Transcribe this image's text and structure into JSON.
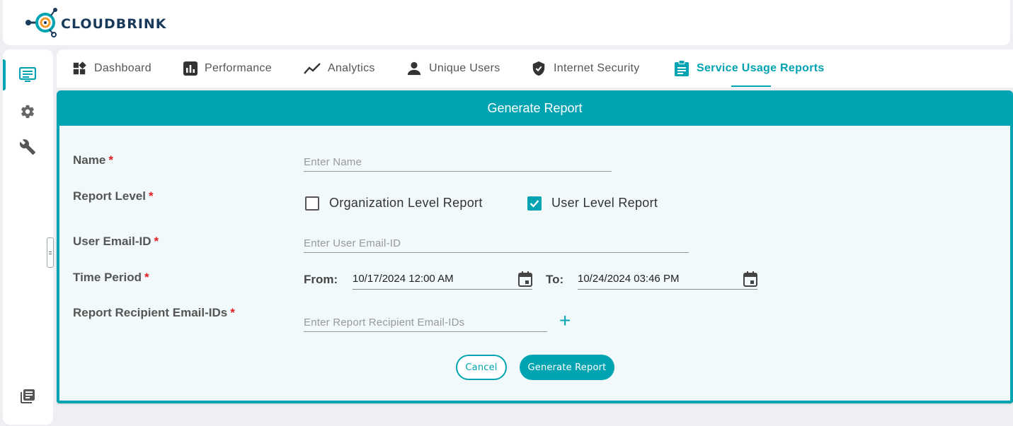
{
  "brand": {
    "name": "CLOUDBRINK",
    "accent": "#00a3b1"
  },
  "sidebar": {
    "items": [
      {
        "icon": "dashboard-list-icon",
        "active": true
      },
      {
        "icon": "gear-icon",
        "active": false
      },
      {
        "icon": "wrench-icon",
        "active": false
      }
    ],
    "bottom_icon": "library-books-icon"
  },
  "tabs": [
    {
      "label": "Dashboard",
      "icon": "dashboard-icon",
      "active": false
    },
    {
      "label": "Performance",
      "icon": "bar-chart-icon",
      "active": false
    },
    {
      "label": "Analytics",
      "icon": "trending-line-icon",
      "active": false
    },
    {
      "label": "Unique Users",
      "icon": "person-icon",
      "active": false
    },
    {
      "label": "Internet Security",
      "icon": "shield-icon",
      "active": false
    },
    {
      "label": "Service Usage Reports",
      "icon": "clipboard-icon",
      "active": true
    }
  ],
  "form": {
    "title": "Generate Report",
    "name": {
      "label": "Name",
      "required": "*",
      "placeholder": "Enter Name",
      "value": ""
    },
    "report_level": {
      "label": "Report Level",
      "required": "*",
      "options": [
        {
          "label": "Organization Level Report",
          "checked": false
        },
        {
          "label": "User Level Report",
          "checked": true
        }
      ]
    },
    "user_email": {
      "label": "User Email-ID",
      "required": "*",
      "placeholder": "Enter User Email-ID",
      "value": ""
    },
    "time_period": {
      "label": "Time Period",
      "required": "*",
      "from_label": "From:",
      "from_value": "10/17/2024 12:00 AM",
      "to_label": "To:",
      "to_value": "10/24/2024 03:46 PM"
    },
    "recipients": {
      "label": "Report Recipient Email-IDs",
      "required": "*",
      "placeholder": "Enter Report Recipient Email-IDs",
      "add_symbol": "+"
    },
    "cancel_label": "Cancel",
    "submit_label": "Generate Report"
  }
}
